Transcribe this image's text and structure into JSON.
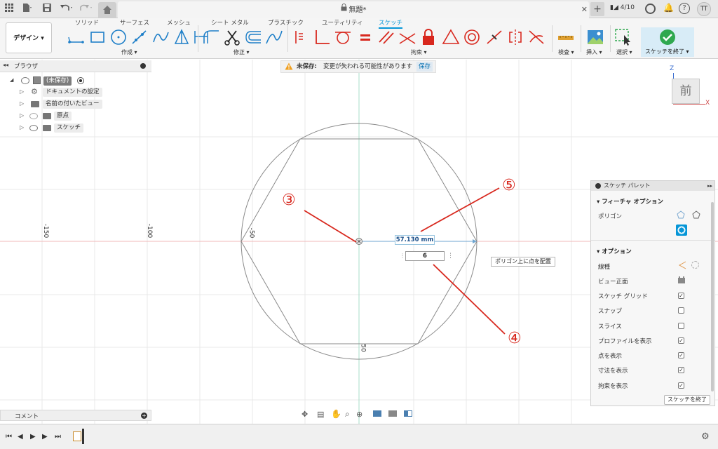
{
  "titlebar": {
    "doc_title": "無題*",
    "job_count": "4/10",
    "user_initials": "TT"
  },
  "toolbar": {
    "workspace_label": "デザイン ▾",
    "tabs": [
      "ソリッド",
      "サーフェス",
      "メッシュ",
      "シート メタル",
      "プラスチック",
      "ユーティリティ",
      "スケッチ"
    ],
    "groups": {
      "create": "作成 ▾",
      "modify": "修正 ▾",
      "constraints": "拘束 ▾",
      "inspect": "検査 ▾",
      "insert": "挿入 ▾",
      "select": "選択 ▾",
      "finish": "スケッチを終了 ▾"
    }
  },
  "browser": {
    "title": "ブラウザ",
    "items": [
      {
        "label": "(未保存)"
      },
      {
        "label": "ドキュメントの設定"
      },
      {
        "label": "名前の付いたビュー"
      },
      {
        "label": "原点"
      },
      {
        "label": "スケッチ"
      }
    ]
  },
  "banner": {
    "label": "未保存:",
    "message": "変更が失われる可能性があります",
    "save": "保存"
  },
  "canvas": {
    "axis_labels": [
      "-150",
      "-100",
      "-50",
      "50"
    ],
    "dimension_value": "57.130 mm",
    "sides_value": "6",
    "tooltip": "ポリゴン上に点を配置",
    "callouts": [
      "③",
      "④",
      "⑤"
    ]
  },
  "viewcube": {
    "face": "前",
    "axis_z": "Z",
    "axis_x": "X"
  },
  "palette": {
    "title": "スケッチ パレット",
    "feature_section": "フィーチャ オプション",
    "polygon_label": "ポリゴン",
    "options_section": "オプション",
    "rows": [
      {
        "label": "線種",
        "checked": null
      },
      {
        "label": "ビュー正面",
        "checked": null
      },
      {
        "label": "スケッチ グリッド",
        "checked": true
      },
      {
        "label": "スナップ",
        "checked": false
      },
      {
        "label": "スライス",
        "checked": false
      },
      {
        "label": "プロファイルを表示",
        "checked": true
      },
      {
        "label": "点を表示",
        "checked": true
      },
      {
        "label": "寸法を表示",
        "checked": true
      },
      {
        "label": "拘束を表示",
        "checked": true
      }
    ],
    "finish_button": "スケッチを終了"
  },
  "comments": {
    "title": "コメント"
  },
  "colors": {
    "accent": "#0696d7",
    "callout": "#d8281e",
    "finish_green": "#2fa84f"
  }
}
